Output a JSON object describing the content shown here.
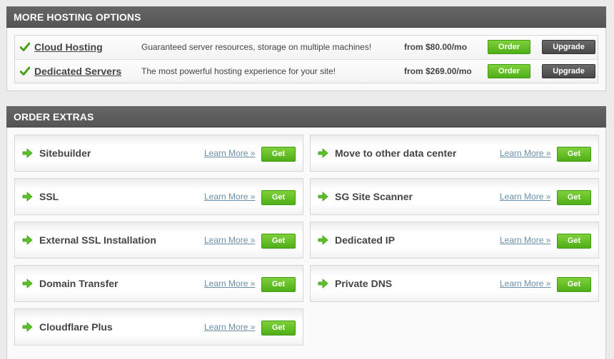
{
  "hosting": {
    "title": "MORE HOSTING OPTIONS",
    "rows": [
      {
        "name": "Cloud Hosting",
        "description": "Guaranteed server resources, storage on multiple machines!",
        "price": "from $80.00/mo",
        "order_label": "Order",
        "upgrade_label": "Upgrade"
      },
      {
        "name": "Dedicated Servers",
        "description": "The most powerful hosting experience for your site!",
        "price": "from $269.00/mo",
        "order_label": "Order",
        "upgrade_label": "Upgrade"
      }
    ]
  },
  "extras": {
    "title": "ORDER EXTRAS",
    "learn_more": "Learn More »",
    "get_label": "Get",
    "items": [
      {
        "name": "Sitebuilder"
      },
      {
        "name": "Move to other data center"
      },
      {
        "name": "SSL"
      },
      {
        "name": "SG Site Scanner"
      },
      {
        "name": "External SSL Installation"
      },
      {
        "name": "Dedicated IP"
      },
      {
        "name": "Domain Transfer"
      },
      {
        "name": "Private DNS"
      },
      {
        "name": "Cloudflare Plus"
      }
    ]
  },
  "colors": {
    "header_bg": "#5c5c5c",
    "order_green": "#5dbb22",
    "upgrade_dark": "#555555",
    "link_blue": "#6a8ea8",
    "check_green": "#4aa11c"
  },
  "icons": {
    "check": "checkmark-icon",
    "arrow": "arrow-right-icon"
  }
}
